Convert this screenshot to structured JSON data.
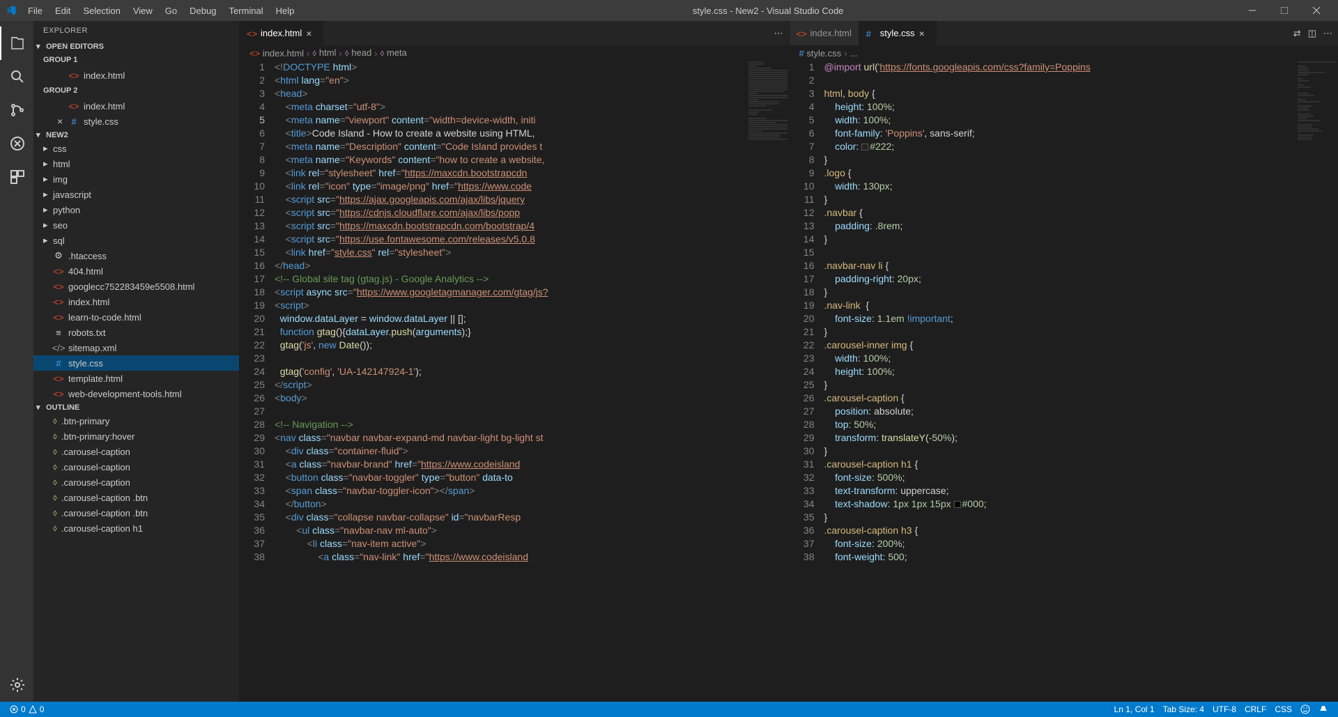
{
  "titlebar": {
    "menus": [
      "File",
      "Edit",
      "Selection",
      "View",
      "Go",
      "Debug",
      "Terminal",
      "Help"
    ],
    "title": "style.css - New2 - Visual Studio Code"
  },
  "sidebar": {
    "title": "EXPLORER",
    "sections": {
      "openEditors": "OPEN EDITORS",
      "group1": "GROUP 1",
      "group2": "GROUP 2",
      "workspace": "NEW2",
      "outline": "OUTLINE"
    },
    "openFiles": {
      "g1": [
        {
          "name": "index.html",
          "icon": "html"
        }
      ],
      "g2": [
        {
          "name": "index.html",
          "icon": "html"
        },
        {
          "name": "style.css",
          "icon": "css",
          "active": true
        }
      ]
    },
    "folders": [
      "css",
      "html",
      "img",
      "javascript",
      "python",
      "seo",
      "sql"
    ],
    "files": [
      {
        "name": ".htaccess",
        "icon": "gear"
      },
      {
        "name": "404.html",
        "icon": "html"
      },
      {
        "name": "googlecc752283459e5508.html",
        "icon": "html"
      },
      {
        "name": "index.html",
        "icon": "html"
      },
      {
        "name": "learn-to-code.html",
        "icon": "html"
      },
      {
        "name": "robots.txt",
        "icon": "txt"
      },
      {
        "name": "sitemap.xml",
        "icon": "xml"
      },
      {
        "name": "style.css",
        "icon": "css",
        "selected": true
      },
      {
        "name": "template.html",
        "icon": "html"
      },
      {
        "name": "web-development-tools.html",
        "icon": "html"
      }
    ],
    "outlineItems": [
      ".btn-primary",
      ".btn-primary:hover",
      ".carousel-caption",
      ".carousel-caption",
      ".carousel-caption",
      ".carousel-caption .btn",
      ".carousel-caption .btn",
      ".carousel-caption h1"
    ]
  },
  "editorLeft": {
    "tabs": [
      {
        "name": "index.html",
        "icon": "html",
        "active": true
      }
    ],
    "breadcrumb": [
      "index.html",
      "html",
      "head",
      "meta"
    ],
    "lines": [
      {
        "n": 1,
        "html": "<span class='punct'>&lt;!</span><span class='tag'>DOCTYPE</span> <span class='attr'>html</span><span class='punct'>&gt;</span>"
      },
      {
        "n": 2,
        "html": "<span class='punct'>&lt;</span><span class='tag'>html</span> <span class='attr'>lang</span><span class='punct'>=</span><span class='str'>\"en\"</span><span class='punct'>&gt;</span>"
      },
      {
        "n": 3,
        "html": "<span class='punct'>&lt;</span><span class='tag'>head</span><span class='punct'>&gt;</span>"
      },
      {
        "n": 4,
        "html": "    <span class='punct'>&lt;</span><span class='tag'>meta</span> <span class='attr'>charset</span><span class='punct'>=</span><span class='str'>\"utf-8\"</span><span class='punct'>&gt;</span>"
      },
      {
        "n": 5,
        "cur": true,
        "html": "    <span class='punct'>&lt;</span><span class='tag'>meta</span> <span class='attr'>name</span><span class='punct'>=</span><span class='str'>\"viewport\"</span> <span class='attr'>content</span><span class='punct'>=</span><span class='str'>\"width=device-width, initi</span>"
      },
      {
        "n": 6,
        "html": "    <span class='punct'>&lt;</span><span class='tag'>title</span><span class='punct'>&gt;</span><span class='text'>Code Island - How to create a website using HTML,</span>"
      },
      {
        "n": 7,
        "html": "    <span class='punct'>&lt;</span><span class='tag'>meta</span> <span class='attr'>name</span><span class='punct'>=</span><span class='str'>\"Description\"</span> <span class='attr'>content</span><span class='punct'>=</span><span class='str'>\"Code Island provides t</span>"
      },
      {
        "n": 8,
        "html": "    <span class='punct'>&lt;</span><span class='tag'>meta</span> <span class='attr'>name</span><span class='punct'>=</span><span class='str'>\"Keywords\"</span> <span class='attr'>content</span><span class='punct'>=</span><span class='str'>\"how to create a website, </span>"
      },
      {
        "n": 9,
        "html": "    <span class='punct'>&lt;</span><span class='tag'>link</span> <span class='attr'>rel</span><span class='punct'>=</span><span class='str'>\"stylesheet\"</span> <span class='attr'>href</span><span class='punct'>=</span><span class='str'>\"<u>https://maxcdn.bootstrapcdn</u></span>"
      },
      {
        "n": 10,
        "html": "    <span class='punct'>&lt;</span><span class='tag'>link</span> <span class='attr'>rel</span><span class='punct'>=</span><span class='str'>\"icon\"</span> <span class='attr'>type</span><span class='punct'>=</span><span class='str'>\"image/png\"</span> <span class='attr'>href</span><span class='punct'>=</span><span class='str'>\"<u>https://www.code</u></span>"
      },
      {
        "n": 11,
        "html": "    <span class='punct'>&lt;</span><span class='tag'>script</span> <span class='attr'>src</span><span class='punct'>=</span><span class='str'>\"<u>https://ajax.googleapis.com/ajax/libs/jquery</u></span>"
      },
      {
        "n": 12,
        "html": "    <span class='punct'>&lt;</span><span class='tag'>script</span> <span class='attr'>src</span><span class='punct'>=</span><span class='str'>\"<u>https://cdnjs.cloudflare.com/ajax/libs/popp</u></span>"
      },
      {
        "n": 13,
        "html": "    <span class='punct'>&lt;</span><span class='tag'>script</span> <span class='attr'>src</span><span class='punct'>=</span><span class='str'>\"<u>https://maxcdn.bootstrapcdn.com/bootstrap/4</u></span>"
      },
      {
        "n": 14,
        "html": "    <span class='punct'>&lt;</span><span class='tag'>script</span> <span class='attr'>src</span><span class='punct'>=</span><span class='str'>\"<u>https://use.fontawesome.com/releases/v5.0.8</u></span>"
      },
      {
        "n": 15,
        "html": "    <span class='punct'>&lt;</span><span class='tag'>link</span> <span class='attr'>href</span><span class='punct'>=</span><span class='str'>\"<u>style.css</u>\"</span> <span class='attr'>rel</span><span class='punct'>=</span><span class='str'>\"stylesheet\"</span><span class='punct'>&gt;</span>"
      },
      {
        "n": 16,
        "html": "<span class='punct'>&lt;/</span><span class='tag'>head</span><span class='punct'>&gt;</span>"
      },
      {
        "n": 17,
        "html": "<span class='comment'>&lt;!-- Global site tag (gtag.js) - Google Analytics --&gt;</span>"
      },
      {
        "n": 18,
        "html": "<span class='punct'>&lt;</span><span class='tag'>script</span> <span class='attr'>async</span> <span class='attr'>src</span><span class='punct'>=</span><span class='str'>\"<u>https://www.googletagmanager.com/gtag/js?</u></span>"
      },
      {
        "n": 19,
        "html": "<span class='punct'>&lt;</span><span class='tag'>script</span><span class='punct'>&gt;</span>"
      },
      {
        "n": 20,
        "html": "  <span class='var'>window</span><span class='text'>.</span><span class='var'>dataLayer</span> <span class='text'>=</span> <span class='var'>window</span><span class='text'>.</span><span class='var'>dataLayer</span> <span class='text'>||</span> <span class='text'>[];</span>"
      },
      {
        "n": 21,
        "html": "  <span class='keyword'>function</span> <span class='func'>gtag</span><span class='text'>(){</span><span class='var'>dataLayer</span><span class='text'>.</span><span class='func'>push</span><span class='text'>(</span><span class='var'>arguments</span><span class='text'>);}</span>"
      },
      {
        "n": 22,
        "html": "  <span class='func'>gtag</span><span class='text'>(</span><span class='str'>'js'</span><span class='text'>, </span><span class='keyword'>new</span> <span class='func'>Date</span><span class='text'>());</span>"
      },
      {
        "n": 23,
        "html": ""
      },
      {
        "n": 24,
        "html": "  <span class='func'>gtag</span><span class='text'>(</span><span class='str'>'config'</span><span class='text'>, </span><span class='str'>'UA-142147924-1'</span><span class='text'>);</span>"
      },
      {
        "n": 25,
        "html": "<span class='punct'>&lt;/</span><span class='tag'>script</span><span class='punct'>&gt;</span>"
      },
      {
        "n": 26,
        "html": "<span class='punct'>&lt;</span><span class='tag'>body</span><span class='punct'>&gt;</span>"
      },
      {
        "n": 27,
        "html": ""
      },
      {
        "n": 28,
        "html": "<span class='comment'>&lt;!-- Navigation --&gt;</span>"
      },
      {
        "n": 29,
        "html": "<span class='punct'>&lt;</span><span class='tag'>nav</span> <span class='attr'>class</span><span class='punct'>=</span><span class='str'>\"navbar navbar-expand-md navbar-light bg-light st</span>"
      },
      {
        "n": 30,
        "html": "    <span class='punct'>&lt;</span><span class='tag'>div</span> <span class='attr'>class</span><span class='punct'>=</span><span class='str'>\"container-fluid\"</span><span class='punct'>&gt;</span>"
      },
      {
        "n": 31,
        "html": "    <span class='punct'>&lt;</span><span class='tag'>a</span> <span class='attr'>class</span><span class='punct'>=</span><span class='str'>\"navbar-brand\"</span> <span class='attr'>href</span><span class='punct'>=</span><span class='str'>\"<u>https://www.codeisland</u></span>"
      },
      {
        "n": 32,
        "html": "    <span class='punct'>&lt;</span><span class='tag'>button</span> <span class='attr'>class</span><span class='punct'>=</span><span class='str'>\"navbar-toggler\"</span> <span class='attr'>type</span><span class='punct'>=</span><span class='str'>\"button\"</span> <span class='attr'>data-to</span>"
      },
      {
        "n": 33,
        "html": "    <span class='punct'>&lt;</span><span class='tag'>span</span> <span class='attr'>class</span><span class='punct'>=</span><span class='str'>\"navbar-toggler-icon\"</span><span class='punct'>&gt;&lt;/</span><span class='tag'>span</span><span class='punct'>&gt;</span>"
      },
      {
        "n": 34,
        "html": "    <span class='punct'>&lt;/</span><span class='tag'>button</span><span class='punct'>&gt;</span>"
      },
      {
        "n": 35,
        "html": "    <span class='punct'>&lt;</span><span class='tag'>div</span> <span class='attr'>class</span><span class='punct'>=</span><span class='str'>\"collapse navbar-collapse\"</span> <span class='attr'>id</span><span class='punct'>=</span><span class='str'>\"navbarResp</span>"
      },
      {
        "n": 36,
        "html": "        <span class='punct'>&lt;</span><span class='tag'>ul</span> <span class='attr'>class</span><span class='punct'>=</span><span class='str'>\"navbar-nav ml-auto\"</span><span class='punct'>&gt;</span>"
      },
      {
        "n": 37,
        "html": "            <span class='punct'>&lt;</span><span class='tag'>li</span> <span class='attr'>class</span><span class='punct'>=</span><span class='str'>\"nav-item active\"</span><span class='punct'>&gt;</span>"
      },
      {
        "n": 38,
        "html": "                <span class='punct'>&lt;</span><span class='tag'>a</span> <span class='attr'>class</span><span class='punct'>=</span><span class='str'>\"nav-link\"</span> <span class='attr'>href</span><span class='punct'>=</span><span class='str'>\"<u>https://www.codeisland</u></span>"
      }
    ]
  },
  "editorRight": {
    "tabs": [
      {
        "name": "index.html",
        "icon": "html",
        "active": false
      },
      {
        "name": "style.css",
        "icon": "css",
        "active": true
      }
    ],
    "breadcrumb": [
      "style.css",
      "..."
    ],
    "lines": [
      {
        "n": 1,
        "html": "<span class='atrule'>@import</span> <span class='func'>url</span><span class='text'>(</span><span class='str'>'<u>https://fonts.googleapis.com/css?family=Poppins</u></span>"
      },
      {
        "n": 2,
        "html": ""
      },
      {
        "n": 3,
        "html": "<span class='selector'>html</span><span class='text'>, </span><span class='selector'>body</span> <span class='text'>{</span>"
      },
      {
        "n": 4,
        "html": "    <span class='prop'>height</span><span class='text'>: </span><span class='num'>100%</span><span class='text'>;</span>"
      },
      {
        "n": 5,
        "html": "    <span class='prop'>width</span><span class='text'>: </span><span class='num'>100%</span><span class='text'>;</span>"
      },
      {
        "n": 6,
        "html": "    <span class='prop'>font-family</span><span class='text'>: </span><span class='str'>'Poppins'</span><span class='text'>, sans-serif;</span>"
      },
      {
        "n": 7,
        "html": "    <span class='prop'>color</span><span class='text'>: </span><span class='colorbox' style='background:#222'></span><span class='num'>#222</span><span class='text'>;</span>"
      },
      {
        "n": 8,
        "html": "<span class='text'>}</span>"
      },
      {
        "n": 9,
        "html": "<span class='selector'>.logo</span> <span class='text'>{</span>"
      },
      {
        "n": 10,
        "html": "    <span class='prop'>width</span><span class='text'>: </span><span class='num'>130px</span><span class='text'>;</span>"
      },
      {
        "n": 11,
        "html": "<span class='text'>}</span>"
      },
      {
        "n": 12,
        "html": "<span class='selector'>.navbar</span> <span class='text'>{</span>"
      },
      {
        "n": 13,
        "html": "    <span class='prop'>padding</span><span class='text'>: </span><span class='num'>.8rem</span><span class='text'>;</span>"
      },
      {
        "n": 14,
        "html": "<span class='text'>}</span>"
      },
      {
        "n": 15,
        "html": ""
      },
      {
        "n": 16,
        "html": "<span class='selector'>.navbar-nav li</span> <span class='text'>{</span>"
      },
      {
        "n": 17,
        "html": "    <span class='prop'>padding-right</span><span class='text'>: </span><span class='num'>20px</span><span class='text'>;</span>"
      },
      {
        "n": 18,
        "html": "<span class='text'>}</span>"
      },
      {
        "n": 19,
        "html": "<span class='selector'>.nav-link</span>  <span class='text'>{</span>"
      },
      {
        "n": 20,
        "html": "    <span class='prop'>font-size</span><span class='text'>: </span><span class='num'>1.1em</span> <span class='important'>!important</span><span class='text'>;</span>"
      },
      {
        "n": 21,
        "html": "<span class='text'>}</span>"
      },
      {
        "n": 22,
        "html": "<span class='selector'>.carousel-inner img</span> <span class='text'>{</span>"
      },
      {
        "n": 23,
        "html": "    <span class='prop'>width</span><span class='text'>: </span><span class='num'>100%</span><span class='text'>;</span>"
      },
      {
        "n": 24,
        "html": "    <span class='prop'>height</span><span class='text'>: </span><span class='num'>100%</span><span class='text'>;</span>"
      },
      {
        "n": 25,
        "html": "<span class='text'>}</span>"
      },
      {
        "n": 26,
        "html": "<span class='selector'>.carousel-caption</span> <span class='text'>{</span>"
      },
      {
        "n": 27,
        "html": "    <span class='prop'>position</span><span class='text'>: absolute;</span>"
      },
      {
        "n": 28,
        "html": "    <span class='prop'>top</span><span class='text'>: </span><span class='num'>50%</span><span class='text'>;</span>"
      },
      {
        "n": 29,
        "html": "    <span class='prop'>transform</span><span class='text'>: </span><span class='func'>translateY</span><span class='text'>(</span><span class='num'>-50%</span><span class='text'>);</span>"
      },
      {
        "n": 30,
        "html": "<span class='text'>}</span>"
      },
      {
        "n": 31,
        "html": "<span class='selector'>.carousel-caption h1</span> <span class='text'>{</span>"
      },
      {
        "n": 32,
        "html": "    <span class='prop'>font-size</span><span class='text'>: </span><span class='num'>500%</span><span class='text'>;</span>"
      },
      {
        "n": 33,
        "html": "    <span class='prop'>text-transform</span><span class='text'>: uppercase;</span>"
      },
      {
        "n": 34,
        "html": "    <span class='prop'>text-shadow</span><span class='text'>: </span><span class='num'>1px 1px 15px</span> <span class='colorbox' style='background:#000'></span><span class='num'>#000</span><span class='text'>;</span>"
      },
      {
        "n": 35,
        "html": "<span class='text'>}</span>"
      },
      {
        "n": 36,
        "html": "<span class='selector'>.carousel-caption h3</span> <span class='text'>{</span>"
      },
      {
        "n": 37,
        "html": "    <span class='prop'>font-size</span><span class='text'>: </span><span class='num'>200%</span><span class='text'>;</span>"
      },
      {
        "n": 38,
        "html": "    <span class='prop'>font-weight</span><span class='text'>: </span><span class='num'>500</span><span class='text'>;</span>"
      }
    ]
  },
  "statusbar": {
    "errors": "0",
    "warnings": "0",
    "lncol": "Ln 1, Col 1",
    "tabsize": "Tab Size: 4",
    "encoding": "UTF-8",
    "eol": "CRLF",
    "lang": "CSS"
  }
}
